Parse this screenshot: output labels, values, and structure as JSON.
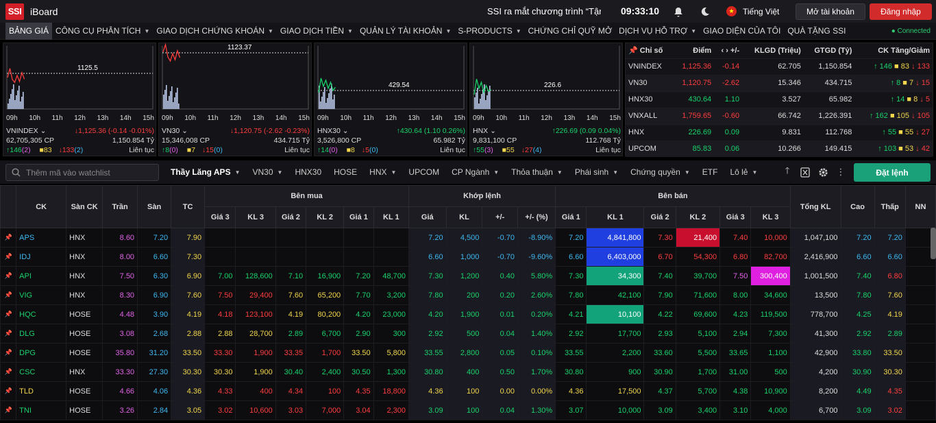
{
  "header": {
    "logo": "SSI",
    "brand": "iBoard",
    "news_ticker": "SSI ra mắt chương trình “Tận dụng",
    "time": "09:33:10",
    "language": "Tiếng Việt",
    "open_account": "Mở tài khoản",
    "login": "Đăng nhập"
  },
  "nav": {
    "items": [
      {
        "label": "BẢNG GIÁ",
        "dropdown": false
      },
      {
        "label": "CÔNG CỤ PHÂN TÍCH",
        "dropdown": true
      },
      {
        "label": "GIAO DỊCH CHỨNG KHOÁN",
        "dropdown": true
      },
      {
        "label": "GIAO DỊCH TIỀN",
        "dropdown": true
      },
      {
        "label": "QUẢN LÝ TÀI KHOẢN",
        "dropdown": true
      },
      {
        "label": "S-PRODUCTS",
        "dropdown": true
      },
      {
        "label": "CHỨNG CHỈ QUỸ MỞ",
        "dropdown": false
      },
      {
        "label": "DỊCH VỤ HỖ TRỢ",
        "dropdown": true
      },
      {
        "label": "GIAO DIỆN CỦA TÔI",
        "dropdown": false
      },
      {
        "label": "QUÀ TẶNG SSI",
        "dropdown": false
      }
    ],
    "status": "Connected"
  },
  "mini_charts": [
    {
      "name": "VNINDEX",
      "ref": "1125.5",
      "change": "↓1,125.36 (-0.14 -0.01%)",
      "change_color": "#ff3d3d",
      "volume": "62,705,305 CP",
      "value": "1,150.854 Tỷ",
      "up": "↑146",
      "up_ceil": "(2)",
      "ref_count": "83",
      "down": "↓133",
      "down_floor": "(2)",
      "session": "Liên tục",
      "trend": [
        0.4,
        0.62,
        0.35,
        0.28,
        0.45,
        0.3,
        0.52,
        0.36
      ],
      "times": [
        "09h",
        "10h",
        "11h",
        "12h",
        "13h",
        "14h",
        "15h"
      ]
    },
    {
      "name": "VN30",
      "ref": "1123.37",
      "change": "↓1,120.75 (-2.62 -0.23%)",
      "change_color": "#ff3d3d",
      "volume": "15,346,008 CP",
      "value": "434.715 Tỷ",
      "up": "↑8",
      "up_ceil": "(0)",
      "ref_count": "7",
      "down": "↓15",
      "down_floor": "(0)",
      "session": "Liên tục",
      "trend": [
        0.52,
        0.7,
        0.4,
        0.3,
        0.48,
        0.33,
        0.55,
        0.38
      ],
      "times": [
        "09h",
        "10h",
        "11h",
        "12h",
        "13h",
        "14h",
        "15h"
      ]
    },
    {
      "name": "HNX30",
      "ref": "429.54",
      "change": "↑430.64 (1.10 0.26%)",
      "change_color": "#19d26b",
      "volume": "3,526,800 CP",
      "value": "65.982 Tỷ",
      "up": "↑14",
      "up_ceil": "(0)",
      "ref_count": "8",
      "down": "↓5",
      "down_floor": "(0)",
      "session": "Liên tục",
      "trend": [
        0.45,
        0.8,
        0.6,
        0.75,
        0.55,
        0.7,
        0.5,
        0.58
      ],
      "times": [
        "09h",
        "10h",
        "11h",
        "12h",
        "13h",
        "14h",
        "15h"
      ]
    },
    {
      "name": "HNX",
      "ref": "226.6",
      "change": "↑226.69 (0.09 0.04%)",
      "change_color": "#19d26b",
      "volume": "9,831,100 CP",
      "value": "112.768 Tỷ",
      "up": "↑55",
      "up_ceil": "(3)",
      "ref_count": "55",
      "down": "↓27",
      "down_floor": "(4)",
      "session": "Liên tục",
      "trend": [
        0.4,
        0.78,
        0.55,
        0.7,
        0.45,
        0.62,
        0.48,
        0.52
      ],
      "times": [
        "09h",
        "10h",
        "11h",
        "12h",
        "13h",
        "14h",
        "15h"
      ]
    }
  ],
  "indices": {
    "headers": [
      "Chỉ số",
      "Điểm",
      "+/-",
      "KLGD (Triệu)",
      "GTGD (Tỷ)",
      "CK Tăng/Giảm"
    ],
    "rows": [
      {
        "name": "VNINDEX",
        "point": "1,125.36",
        "chg": "-0.14",
        "vol": "62.705",
        "val": "1,150.854",
        "up": "↑ 146",
        "ref": "83",
        "down": "↓ 133",
        "color": "#ff3d3d"
      },
      {
        "name": "VN30",
        "point": "1,120.75",
        "chg": "-2.62",
        "vol": "15.346",
        "val": "434.715",
        "up": "↑ 8",
        "ref": "7",
        "down": "↓ 15",
        "color": "#ff3d3d"
      },
      {
        "name": "HNX30",
        "point": "430.64",
        "chg": "1.10",
        "vol": "3.527",
        "val": "65.982",
        "up": "↑ 14",
        "ref": "8",
        "down": "↓ 5",
        "color": "#19d26b"
      },
      {
        "name": "VNXALL",
        "point": "1,759.65",
        "chg": "-0.60",
        "vol": "66.742",
        "val": "1,226.391",
        "up": "↑ 162",
        "ref": "105",
        "down": "↓ 105",
        "color": "#ff3d3d"
      },
      {
        "name": "HNX",
        "point": "226.69",
        "chg": "0.09",
        "vol": "9.831",
        "val": "112.768",
        "up": "↑ 55",
        "ref": "55",
        "down": "↓ 27",
        "color": "#19d26b"
      },
      {
        "name": "UPCOM",
        "point": "85.83",
        "chg": "0.06",
        "vol": "10.266",
        "val": "149.415",
        "up": "↑ 103",
        "ref": "53",
        "down": "↓ 42",
        "color": "#19d26b"
      }
    ]
  },
  "watchlist": {
    "search_placeholder": "Thêm mã vào watchlist",
    "tabs": [
      {
        "label": "Thầy Lăng APS",
        "dropdown": true,
        "active": true
      },
      {
        "label": "VN30",
        "dropdown": true
      },
      {
        "label": "HNX30",
        "dropdown": false
      },
      {
        "label": "HOSE",
        "dropdown": false
      },
      {
        "label": "HNX",
        "dropdown": true
      },
      {
        "label": "UPCOM",
        "dropdown": false
      },
      {
        "label": "CP Ngành",
        "dropdown": true
      },
      {
        "label": "Thỏa thuận",
        "dropdown": true
      },
      {
        "label": "Phái sinh",
        "dropdown": true
      },
      {
        "label": "Chứng quyền",
        "dropdown": true
      },
      {
        "label": "ETF",
        "dropdown": false
      },
      {
        "label": "Lô lẻ",
        "dropdown": true
      }
    ],
    "order_button": "Đặt lệnh"
  },
  "board": {
    "groups": {
      "buy": "Bên mua",
      "match": "Khớp lệnh",
      "sell": "Bên bán"
    },
    "headers": {
      "sym": "CK",
      "ex": "Sàn CK",
      "ceil": "Trần",
      "floor": "Sàn",
      "ref": "TC",
      "p3": "Giá 3",
      "v3": "KL 3",
      "p2": "Giá 2",
      "v2": "KL 2",
      "p1": "Giá 1",
      "v1": "KL 1",
      "mp": "Giá",
      "mv": "KL",
      "chg": "+/-",
      "pct": "+/- (%)",
      "s1p": "Giá 1",
      "s1v": "KL 1",
      "s2p": "Giá 2",
      "s2v": "KL 2",
      "s3p": "Giá 3",
      "s3v": "KL 3",
      "total": "Tổng KL",
      "high": "Cao",
      "low": "Thấp",
      "nn": "NN"
    },
    "rows": [
      {
        "sym": "APS",
        "ex": "HNX",
        "ceil": "8.60",
        "floor": "7.20",
        "ref": "7.90",
        "b": [
          [
            "",
            ""
          ],
          [
            "",
            ""
          ],
          [
            "",
            ""
          ]
        ],
        "bc": [
          "",
          "",
          ""
        ],
        "mp": "7.20",
        "mv": "4,500",
        "chg": "-0.70",
        "pct": "-8.90%",
        "mc": "floor",
        "s": [
          [
            "7.20",
            "4,841,800"
          ],
          [
            "7.30",
            "21,400"
          ],
          [
            "7.40",
            "10,000"
          ]
        ],
        "sc": [
          "floor",
          "down",
          "down"
        ],
        "sv_bg": [
          "#1f3fe0",
          "#c8102e",
          ""
        ],
        "total": "1,047,100",
        "high": "7.20",
        "low": "7.20",
        "hc": "floor",
        "lc": "floor"
      },
      {
        "sym": "IDJ",
        "ex": "HNX",
        "ceil": "8.00",
        "floor": "6.60",
        "ref": "7.30",
        "b": [
          [
            "",
            ""
          ],
          [
            "",
            ""
          ],
          [
            "",
            ""
          ]
        ],
        "bc": [
          "",
          "",
          ""
        ],
        "mp": "6.60",
        "mv": "1,000",
        "chg": "-0.70",
        "pct": "-9.60%",
        "mc": "floor",
        "s": [
          [
            "6.60",
            "6,403,000"
          ],
          [
            "6.70",
            "54,300"
          ],
          [
            "6.80",
            "82,700"
          ]
        ],
        "sc": [
          "floor",
          "down",
          "down"
        ],
        "sv_bg": [
          "#1f3fe0",
          "",
          ""
        ],
        "total": "2,416,900",
        "high": "6.60",
        "low": "6.60",
        "hc": "floor",
        "lc": "floor"
      },
      {
        "sym": "API",
        "ex": "HNX",
        "ceil": "7.50",
        "floor": "6.30",
        "ref": "6.90",
        "b": [
          [
            "7.00",
            "128,600"
          ],
          [
            "7.10",
            "16,900"
          ],
          [
            "7.20",
            "48,700"
          ]
        ],
        "bc": [
          "up",
          "up",
          "up"
        ],
        "mp": "7.30",
        "mv": "1,200",
        "chg": "0.40",
        "pct": "5.80%",
        "mc": "up",
        "s": [
          [
            "7.30",
            "34,300"
          ],
          [
            "7.40",
            "39,700"
          ],
          [
            "7.50",
            "300,400"
          ]
        ],
        "sc": [
          "up",
          "up",
          "ceil"
        ],
        "sv_bg": [
          "#12a37a",
          "",
          "#e020e0"
        ],
        "total": "1,001,500",
        "high": "7.40",
        "low": "6.80",
        "hc": "up",
        "lc": "down"
      },
      {
        "sym": "VIG",
        "ex": "HNX",
        "ceil": "8.30",
        "floor": "6.90",
        "ref": "7.60",
        "b": [
          [
            "7.50",
            "29,400"
          ],
          [
            "7.60",
            "65,200"
          ],
          [
            "7.70",
            "3,200"
          ]
        ],
        "bc": [
          "down",
          "ref",
          "up"
        ],
        "mp": "7.80",
        "mv": "200",
        "chg": "0.20",
        "pct": "2.60%",
        "mc": "up",
        "s": [
          [
            "7.80",
            "42,100"
          ],
          [
            "7.90",
            "71,600"
          ],
          [
            "8.00",
            "34,600"
          ]
        ],
        "sc": [
          "up",
          "up",
          "up"
        ],
        "sv_bg": [
          "",
          "",
          ""
        ],
        "total": "13,500",
        "high": "7.80",
        "low": "7.60",
        "hc": "up",
        "lc": "ref"
      },
      {
        "sym": "HQC",
        "ex": "HOSE",
        "ceil": "4.48",
        "floor": "3.90",
        "ref": "4.19",
        "b": [
          [
            "4.18",
            "123,100"
          ],
          [
            "4.19",
            "80,200"
          ],
          [
            "4.20",
            "23,000"
          ]
        ],
        "bc": [
          "down",
          "ref",
          "up"
        ],
        "mp": "4.20",
        "mv": "1,900",
        "chg": "0.01",
        "pct": "0.20%",
        "mc": "up",
        "s": [
          [
            "4.21",
            "10,100"
          ],
          [
            "4.22",
            "69,600"
          ],
          [
            "4.23",
            "119,500"
          ]
        ],
        "sc": [
          "up",
          "up",
          "up"
        ],
        "sv_bg": [
          "#12a37a",
          "",
          ""
        ],
        "total": "778,700",
        "high": "4.25",
        "low": "4.19",
        "hc": "up",
        "lc": "ref"
      },
      {
        "sym": "DLG",
        "ex": "HOSE",
        "ceil": "3.08",
        "floor": "2.68",
        "ref": "2.88",
        "b": [
          [
            "2.88",
            "28,700"
          ],
          [
            "2.89",
            "6,700"
          ],
          [
            "2.90",
            "300"
          ]
        ],
        "bc": [
          "ref",
          "up",
          "up"
        ],
        "mp": "2.92",
        "mv": "500",
        "chg": "0.04",
        "pct": "1.40%",
        "mc": "up",
        "s": [
          [
            "2.92",
            "17,700"
          ],
          [
            "2.93",
            "5,100"
          ],
          [
            "2.94",
            "7,300"
          ]
        ],
        "sc": [
          "up",
          "up",
          "up"
        ],
        "sv_bg": [
          "",
          "",
          ""
        ],
        "total": "41,300",
        "high": "2.92",
        "low": "2.89",
        "hc": "up",
        "lc": "up"
      },
      {
        "sym": "DPG",
        "ex": "HOSE",
        "ceil": "35.80",
        "floor": "31.20",
        "ref": "33.50",
        "b": [
          [
            "33.30",
            "1,900"
          ],
          [
            "33.35",
            "1,700"
          ],
          [
            "33.50",
            "5,800"
          ]
        ],
        "bc": [
          "down",
          "down",
          "ref"
        ],
        "mp": "33.55",
        "mv": "2,800",
        "chg": "0.05",
        "pct": "0.10%",
        "mc": "up",
        "s": [
          [
            "33.55",
            "2,200"
          ],
          [
            "33.60",
            "5,500"
          ],
          [
            "33.65",
            "1,100"
          ]
        ],
        "sc": [
          "up",
          "up",
          "up"
        ],
        "sv_bg": [
          "",
          "",
          ""
        ],
        "total": "42,900",
        "high": "33.80",
        "low": "33.50",
        "hc": "up",
        "lc": "ref"
      },
      {
        "sym": "CSC",
        "ex": "HNX",
        "ceil": "33.30",
        "floor": "27.30",
        "ref": "30.30",
        "b": [
          [
            "30.30",
            "1,900"
          ],
          [
            "30.40",
            "2,400"
          ],
          [
            "30.50",
            "1,300"
          ]
        ],
        "bc": [
          "ref",
          "up",
          "up"
        ],
        "mp": "30.80",
        "mv": "400",
        "chg": "0.50",
        "pct": "1.70%",
        "mc": "up",
        "s": [
          [
            "30.80",
            "900"
          ],
          [
            "30.90",
            "1,700"
          ],
          [
            "31.00",
            "500"
          ]
        ],
        "sc": [
          "up",
          "up",
          "up"
        ],
        "sv_bg": [
          "",
          "",
          ""
        ],
        "total": "4,200",
        "high": "30.90",
        "low": "30.30",
        "hc": "up",
        "lc": "ref"
      },
      {
        "sym": "TLD",
        "ex": "HOSE",
        "ceil": "4.66",
        "floor": "4.06",
        "ref": "4.36",
        "b": [
          [
            "4.33",
            "400"
          ],
          [
            "4.34",
            "100"
          ],
          [
            "4.35",
            "18,800"
          ]
        ],
        "bc": [
          "down",
          "down",
          "down"
        ],
        "mp": "4.36",
        "mv": "100",
        "chg": "0.00",
        "pct": "0.00%",
        "mc": "ref",
        "s": [
          [
            "4.36",
            "17,500"
          ],
          [
            "4.37",
            "5,700"
          ],
          [
            "4.38",
            "10,900"
          ]
        ],
        "sc": [
          "ref",
          "up",
          "up"
        ],
        "sv_bg": [
          "",
          "",
          ""
        ],
        "total": "8,200",
        "high": "4.49",
        "low": "4.35",
        "hc": "up",
        "lc": "down"
      },
      {
        "sym": "TNI",
        "ex": "HOSE",
        "ceil": "3.26",
        "floor": "2.84",
        "ref": "3.05",
        "b": [
          [
            "3.02",
            "10,600"
          ],
          [
            "3.03",
            "7,000"
          ],
          [
            "3.04",
            "2,300"
          ]
        ],
        "bc": [
          "down",
          "down",
          "down"
        ],
        "mp": "3.09",
        "mv": "100",
        "chg": "0.04",
        "pct": "1.30%",
        "mc": "up",
        "s": [
          [
            "3.07",
            "10,000"
          ],
          [
            "3.09",
            "3,400"
          ],
          [
            "3.10",
            "4,000"
          ]
        ],
        "sc": [
          "up",
          "up",
          "up"
        ],
        "sv_bg": [
          "",
          "",
          ""
        ],
        "total": "6,700",
        "high": "3.09",
        "low": "3.02",
        "hc": "up",
        "lc": "down"
      }
    ]
  }
}
